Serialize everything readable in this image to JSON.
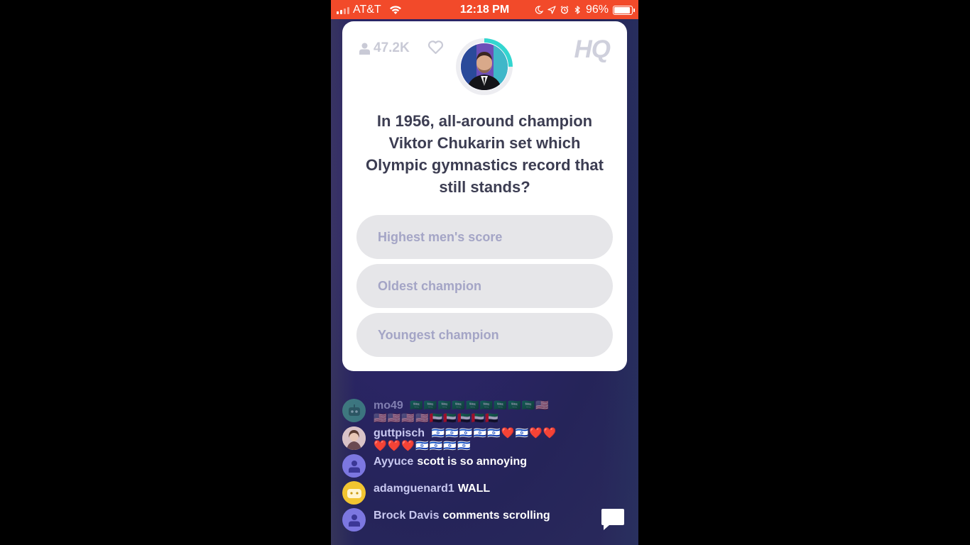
{
  "status_bar": {
    "carrier": "AT&T",
    "time": "12:18 PM",
    "battery": "96%",
    "battery_level": 0.96,
    "icons": [
      "signal-icon",
      "wifi-icon",
      "moon-icon",
      "location-icon",
      "alarm-icon",
      "bluetooth-icon",
      "battery-icon"
    ]
  },
  "card": {
    "viewer_count": "47.2K",
    "logo": "HQ",
    "question": "In 1956, all-around champion Viktor Chukarin set which Olympic gymnastics record that still stands?",
    "answers": [
      {
        "label": "Highest men's score"
      },
      {
        "label": "Oldest champion"
      },
      {
        "label": "Youngest champion"
      }
    ]
  },
  "comments": [
    {
      "user": "mo49",
      "message": "",
      "emoji": [
        "🇸🇦🇸🇦🇸🇦🇸🇦🇸🇦🇸🇦🇸🇦🇸🇦🇸🇦🇺🇸",
        "🇺🇸🇺🇸🇺🇸🇺🇸🇦🇪🇦🇪🇦🇪🇦🇪🇦🇪"
      ],
      "avatar": "robot-avatar",
      "avatar_color": "#4db89a"
    },
    {
      "user": "guttpisch",
      "message": "",
      "emoji": [
        "🇮🇱🇮🇱🇮🇱🇮🇱🇮🇱❤️🇮🇱❤️❤️",
        "❤️❤️❤️🇮🇱🇮🇱🇮🇱🇮🇱"
      ],
      "avatar": "photo-avatar",
      "avatar_color": "#d9c3c8"
    },
    {
      "user": "Ayyuce",
      "message": "scott is so annoying",
      "avatar": "person-avatar",
      "avatar_color": "#7c77e0"
    },
    {
      "user": "adamguenard1",
      "message": "WALL",
      "avatar": "smiley-avatar",
      "avatar_color": "#f2c531"
    },
    {
      "user": "Brock Davis",
      "message": "comments scrolling",
      "avatar": "person-avatar",
      "avatar_color": "#7c77e0"
    }
  ],
  "colors": {
    "status_bar": "#f24a2a",
    "question_text": "#3c3d52",
    "answer_bg": "#e6e6e9",
    "answer_text": "#a4a5c6",
    "timer_ring": "#33d6d0"
  }
}
